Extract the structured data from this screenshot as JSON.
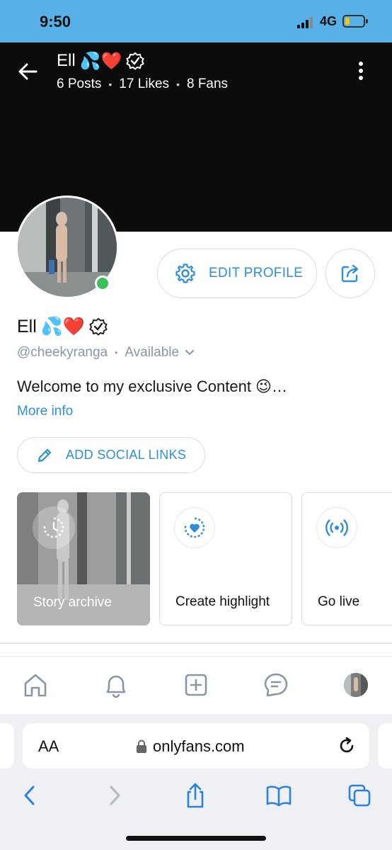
{
  "status_bar": {
    "time": "9:50",
    "network": "4G"
  },
  "header": {
    "name": "Ell",
    "name_emoji": "💦❤️",
    "stats": {
      "posts": "6 Posts",
      "likes": "17 Likes",
      "fans": "8 Fans"
    }
  },
  "profile": {
    "name": "Ell",
    "name_emoji": "💦❤️",
    "handle": "@cheekyranga",
    "availability": "Available",
    "bio": "Welcome to my exclusive Content 😉…",
    "more_info": "More info",
    "edit_profile_label": "EDIT PROFILE",
    "add_social_links_label": "ADD SOCIAL LINKS"
  },
  "highlights": [
    {
      "label": "Story archive"
    },
    {
      "label": "Create highlight"
    },
    {
      "label": "Go live"
    }
  ],
  "browser": {
    "text_size": "AA",
    "url": "onlyfans.com"
  },
  "colors": {
    "accent": "#2f8fd6",
    "status_bar": "#57b0e6",
    "online": "#3bbf5a"
  }
}
